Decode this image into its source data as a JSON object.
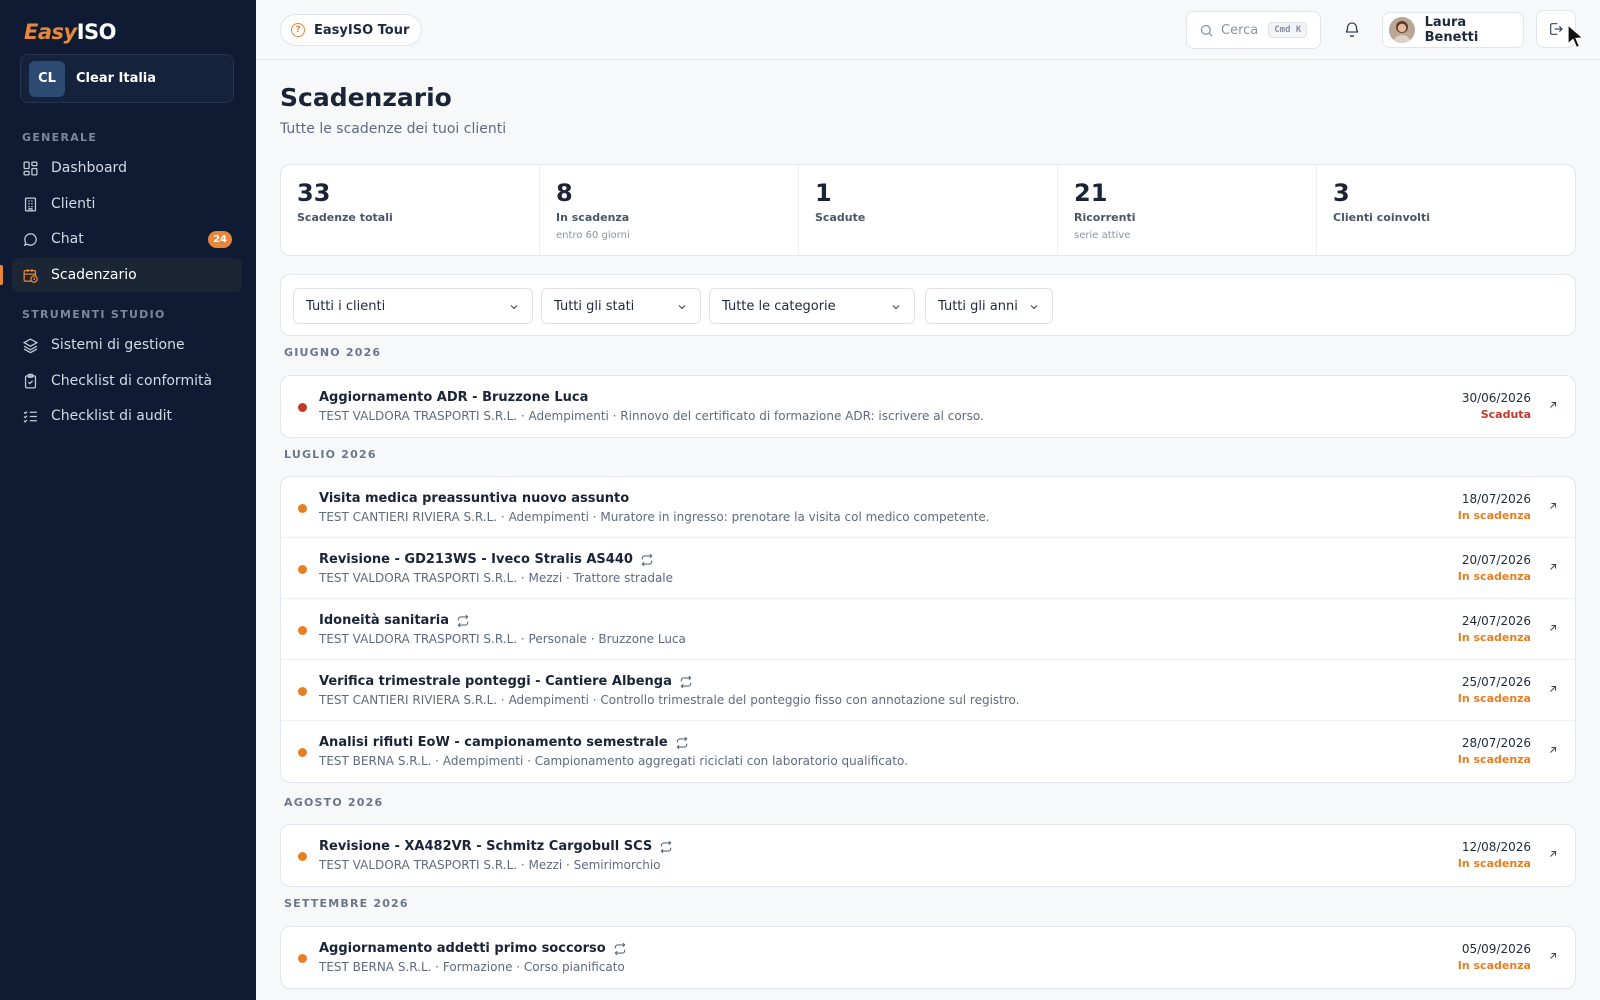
{
  "app": {
    "logo_part1": "Easy",
    "logo_part2": "ISO",
    "org_initials": "CL",
    "org_name": "Clear Italia"
  },
  "sidebar": {
    "section_general": "GENERALE",
    "section_tools": "STRUMENTI STUDIO",
    "items": [
      {
        "label": "Dashboard",
        "icon": "grid-icon"
      },
      {
        "label": "Clienti",
        "icon": "building-icon"
      },
      {
        "label": "Chat",
        "icon": "chat-icon",
        "badge": "24"
      },
      {
        "label": "Scadenzario",
        "icon": "calendar-clock-icon",
        "active": true
      },
      {
        "label": "Sistemi di gestione",
        "icon": "layers-icon"
      },
      {
        "label": "Checklist di conformità",
        "icon": "clipboard-check-icon"
      },
      {
        "label": "Checklist di audit",
        "icon": "list-check-icon"
      }
    ]
  },
  "header": {
    "tour_label": "EasyISO Tour",
    "search_placeholder": "Cerca",
    "search_shortcut": "Cmd K",
    "user_name": "Laura Benetti"
  },
  "page": {
    "title": "Scadenzario",
    "subtitle": "Tutte le scadenze dei tuoi clienti"
  },
  "stats": [
    {
      "value": "33",
      "label": "Scadenze totali",
      "sub": ""
    },
    {
      "value": "8",
      "label": "In scadenza",
      "sub": "entro 60 giorni"
    },
    {
      "value": "1",
      "label": "Scadute",
      "sub": ""
    },
    {
      "value": "21",
      "label": "Ricorrenti",
      "sub": "serie attive"
    },
    {
      "value": "3",
      "label": "Clienti coinvolti",
      "sub": ""
    }
  ],
  "filters": {
    "clients": "Tutti i clienti",
    "states": "Tutti gli stati",
    "categories": "Tutte le categorie",
    "years": "Tutti gli anni"
  },
  "colors": {
    "accent": "#e8873a",
    "expired": "#c0392b",
    "expiring": "#e67e22"
  },
  "months": [
    {
      "label": "GIUGNO 2026",
      "rows": [
        {
          "title": "Aggiornamento ADR - Bruzzone Luca",
          "recurring": false,
          "meta": "TEST VALDORA TRASPORTI S.R.L. · Adempimenti · Rinnovo del certificato di formazione ADR: iscrivere al corso.",
          "date": "30/06/2026",
          "status": "Scaduta",
          "status_type": "expired"
        }
      ]
    },
    {
      "label": "LUGLIO 2026",
      "rows": [
        {
          "title": "Visita medica preassuntiva nuovo assunto",
          "recurring": false,
          "meta": "TEST CANTIERI RIVIERA S.R.L. · Adempimenti · Muratore in ingresso: prenotare la visita col medico competente.",
          "date": "18/07/2026",
          "status": "In scadenza",
          "status_type": "expiring"
        },
        {
          "title": "Revisione - GD213WS - Iveco Stralis AS440",
          "recurring": true,
          "meta": "TEST VALDORA TRASPORTI S.R.L. · Mezzi · Trattore stradale",
          "date": "20/07/2026",
          "status": "In scadenza",
          "status_type": "expiring"
        },
        {
          "title": "Idoneità sanitaria",
          "recurring": true,
          "meta": "TEST VALDORA TRASPORTI S.R.L. · Personale · Bruzzone Luca",
          "date": "24/07/2026",
          "status": "In scadenza",
          "status_type": "expiring"
        },
        {
          "title": "Verifica trimestrale ponteggi - Cantiere Albenga",
          "recurring": true,
          "meta": "TEST CANTIERI RIVIERA S.R.L. · Adempimenti · Controllo trimestrale del ponteggio fisso con annotazione sul registro.",
          "date": "25/07/2026",
          "status": "In scadenza",
          "status_type": "expiring"
        },
        {
          "title": "Analisi rifiuti EoW - campionamento semestrale",
          "recurring": true,
          "meta": "TEST BERNA S.R.L. · Adempimenti · Campionamento aggregati riciclati con laboratorio qualificato.",
          "date": "28/07/2026",
          "status": "In scadenza",
          "status_type": "expiring"
        }
      ]
    },
    {
      "label": "AGOSTO 2026",
      "rows": [
        {
          "title": "Revisione - XA482VR - Schmitz Cargobull SCS",
          "recurring": true,
          "meta": "TEST VALDORA TRASPORTI S.R.L. · Mezzi · Semirimorchio",
          "date": "12/08/2026",
          "status": "In scadenza",
          "status_type": "expiring"
        }
      ]
    },
    {
      "label": "SETTEMBRE 2026",
      "rows": [
        {
          "title": "Aggiornamento addetti primo soccorso",
          "recurring": true,
          "meta": "TEST BERNA S.R.L. · Formazione · Corso pianificato",
          "date": "05/09/2026",
          "status": "In scadenza",
          "status_type": "expiring"
        }
      ]
    }
  ]
}
